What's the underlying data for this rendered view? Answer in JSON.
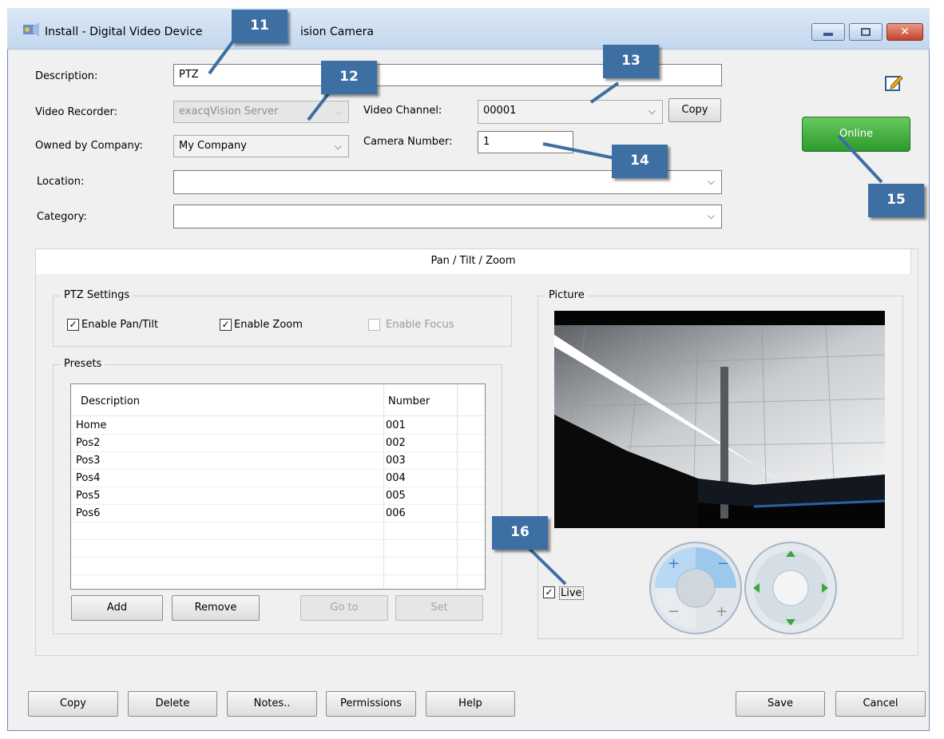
{
  "window": {
    "title": "Install - Digital Video Device - exacqVision Camera",
    "title_visible_left": "Install - Digital Video Device",
    "title_visible_right": "ision Camera",
    "minimize_icon": "minimize-icon",
    "maximize_icon": "maximize-icon",
    "close_icon": "close-icon"
  },
  "form": {
    "description_label": "Description:",
    "description_value": "PTZ",
    "video_recorder_label": "Video Recorder:",
    "video_recorder_value": "exacqVision Server",
    "video_channel_label": "Video Channel:",
    "video_channel_value": "00001",
    "copy_label": "Copy",
    "owned_label": "Owned by Company:",
    "owned_value": "My Company",
    "camera_number_label": "Camera Number:",
    "camera_number_value": "1",
    "location_label": "Location:",
    "location_value": "",
    "category_label": "Category:",
    "category_value": ""
  },
  "status": {
    "online_label": "Online",
    "online_color": "#3aa63a",
    "notes_icon": "edit-note-icon"
  },
  "tab": {
    "label": "Pan / Tilt / Zoom"
  },
  "ptz": {
    "group_label": "PTZ Settings",
    "pan_tilt": {
      "label": "Enable Pan/Tilt",
      "checked": true
    },
    "zoom": {
      "label": "Enable Zoom",
      "checked": true
    },
    "focus": {
      "label": "Enable Focus",
      "checked": false
    }
  },
  "presets": {
    "group_label": "Presets",
    "col_description": "Description",
    "col_number": "Number",
    "rows": [
      {
        "description": "Home",
        "number": "001"
      },
      {
        "description": "Pos2",
        "number": "002"
      },
      {
        "description": "Pos3",
        "number": "003"
      },
      {
        "description": "Pos4",
        "number": "004"
      },
      {
        "description": "Pos5",
        "number": "005"
      },
      {
        "description": "Pos6",
        "number": "006"
      }
    ],
    "add_label": "Add",
    "remove_label": "Remove",
    "goto_label": "Go to",
    "set_label": "Set"
  },
  "picture": {
    "group_label": "Picture",
    "live_label": "Live",
    "live_checked": true,
    "zoom_control_icon": "zoom-focus-control-icon",
    "pan_control_icon": "pan-tilt-control-icon"
  },
  "footer": {
    "copy_label": "Copy",
    "delete_label": "Delete",
    "notes_label": "Notes..",
    "permissions_label": "Permissions",
    "help_label": "Help",
    "save_label": "Save",
    "cancel_label": "Cancel"
  },
  "callouts": {
    "c11": "11",
    "c12": "12",
    "c13": "13",
    "c14": "14",
    "c15": "15",
    "c16": "16",
    "color": "#3d6fa3"
  }
}
